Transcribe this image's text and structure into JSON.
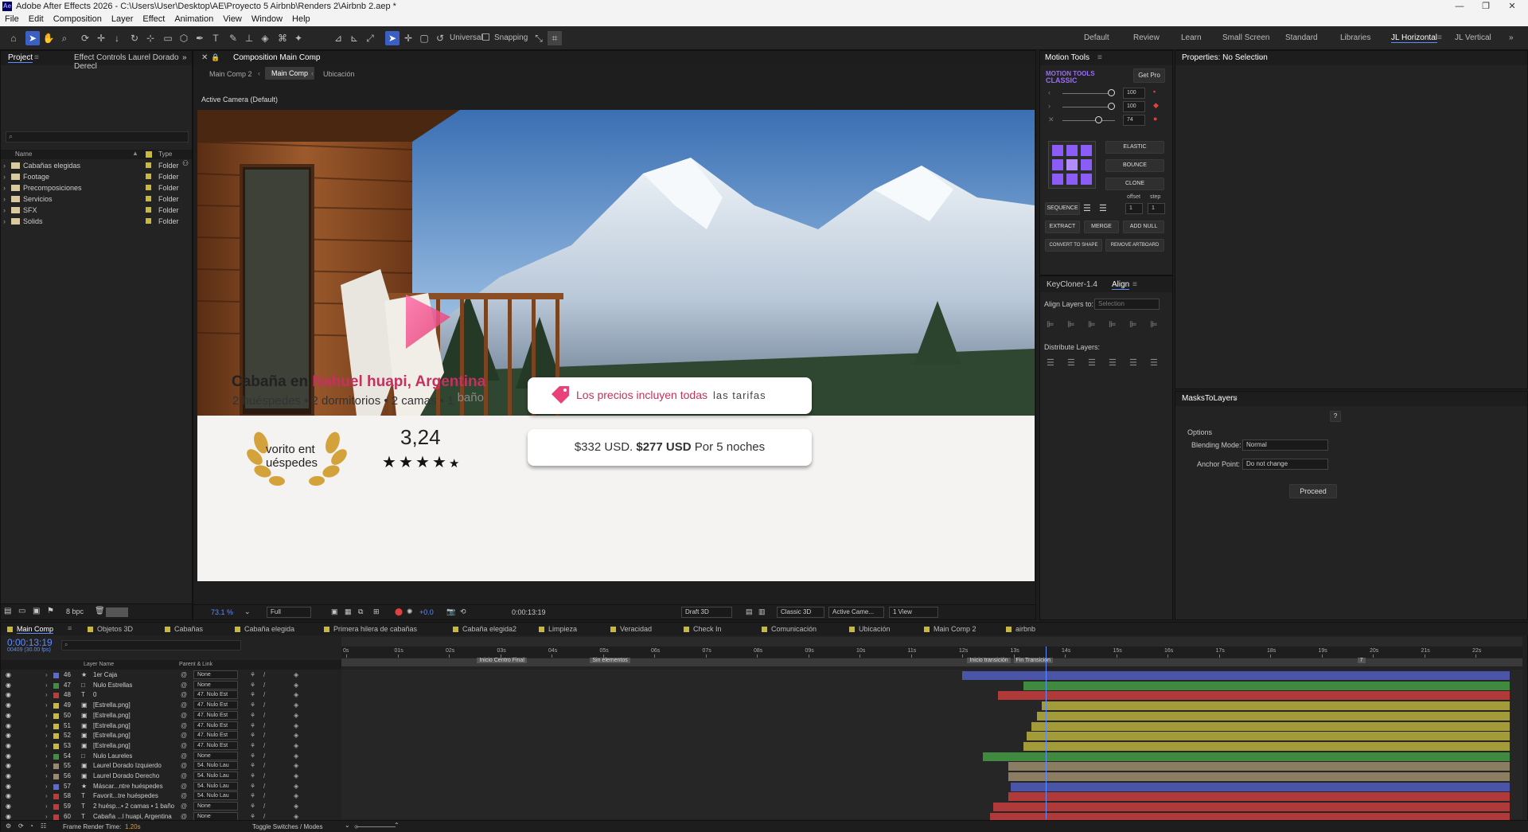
{
  "window": {
    "title": "Adobe After Effects 2026 - C:\\Users\\User\\Desktop\\AE\\Proyecto 5 Airbnb\\Renders 2\\Airbnb 2.aep *",
    "controls": [
      "—",
      "❐",
      "✕"
    ]
  },
  "menu": [
    "File",
    "Edit",
    "Composition",
    "Layer",
    "Effect",
    "Animation",
    "View",
    "Window",
    "Help"
  ],
  "toolbar": {
    "universal_label": "Universal",
    "snapping_label": "Snapping"
  },
  "workspaces": [
    "Default",
    "Review",
    "Learn",
    "Small Screen",
    "Standard",
    "Libraries",
    "JL Horizontal",
    "JL Vertical"
  ],
  "workspace_active": "JL Horizontal",
  "project_panel": {
    "tabs": [
      "Project",
      "Effect Controls Laurel Dorado Derecl"
    ],
    "search_placeholder": "",
    "columns": [
      "Name",
      "Type"
    ],
    "items": [
      {
        "name": "Cabañas elegidas",
        "type": "Folder"
      },
      {
        "name": "Footage",
        "type": "Folder"
      },
      {
        "name": "Precomposiciones",
        "type": "Folder"
      },
      {
        "name": "Servicios",
        "type": "Folder"
      },
      {
        "name": "SFX",
        "type": "Folder"
      },
      {
        "name": "Solids",
        "type": "Folder"
      }
    ],
    "bpc": "8 bpc"
  },
  "composition_panel": {
    "title": "Composition Main Comp",
    "breadcrumbs": [
      "Main Comp 2",
      "Main Comp",
      "Ubicación"
    ],
    "active_crumb": "Main Comp",
    "camera_label": "Active Camera (Default)",
    "footer": {
      "zoom": "73.1 %",
      "resolution": "Full",
      "exposure": "+0.0",
      "timecode": "0:00:13:19",
      "draft": "Draft 3D",
      "renderer": "Classic 3D",
      "camera": "Active Came...",
      "views": "1 View"
    }
  },
  "card": {
    "title_prefix": "Cabaña en ",
    "title_accent": "Nahuel huapi, Argentina",
    "subtitle": "2 huéspedes • 2 dormitorios • 2 camas • 1 ",
    "subtitle_tail": "baño",
    "laurel_text_line1": "vorito ent",
    "laurel_text_line2": "uéspedes",
    "rating": "3,24",
    "stars": [
      "★",
      "★",
      "★",
      "★",
      "★"
    ],
    "price_note_accent": "Los precios incluyen todas",
    "price_note_tail": "las tarifas",
    "price_old": "$332 USD.",
    "price_new": "$277 USD",
    "price_suffix": "Por 5 noches"
  },
  "motion_tools": {
    "tab": "Motion Tools",
    "brand_line1": "MOTION TOOLS",
    "brand_line2": "CLASSIC",
    "get_pro": "Get Pro",
    "sliders": [
      "100",
      "100",
      "74"
    ],
    "buttons": {
      "elastic": "ELASTIC",
      "bounce": "BOUNCE",
      "clone": "CLONE",
      "sequence": "SEQUENCE",
      "offset": "offset",
      "step": "step",
      "offset_val": "1",
      "step_val": "1",
      "extract": "EXTRACT",
      "merge": "MERGE",
      "add_null": "ADD NULL",
      "convert": "CONVERT TO SHAPE",
      "remove": "REMOVE ARTBOARD"
    }
  },
  "align_panel": {
    "tabs": [
      "KeyCloner-1.4",
      "Align"
    ],
    "align_to_label": "Align Layers to:",
    "align_to_value": "Selection",
    "distribute_label": "Distribute Layers:"
  },
  "properties_panel": {
    "title": "Properties: No Selection"
  },
  "masks_panel": {
    "title": "MasksToLayers",
    "help": "?",
    "options_label": "Options",
    "blending_label": "Blending Mode:",
    "blending_value": "Normal",
    "anchor_label": "Anchor Point:",
    "anchor_value": "Do not change",
    "proceed": "Proceed"
  },
  "timeline": {
    "tabs": [
      "Main Comp",
      "Objetos 3D",
      "Cabañas",
      "Cabaña elegida",
      "Primera hilera de cabañas",
      "Cabaña elegida2",
      "Limpieza",
      "Veracidad",
      "Check In",
      "Comunicación",
      "Ubicación",
      "Main Comp 2",
      "airbnb"
    ],
    "timecode": "0:00:13:19",
    "timecode_sub": "00409 (30.00 fps)",
    "columns": {
      "layer_name": "Layer Name",
      "parent": "Parent & Link"
    },
    "ruler": [
      "0s",
      "01s",
      "02s",
      "03s",
      "04s",
      "05s",
      "06s",
      "07s",
      "08s",
      "09s",
      "10s",
      "11s",
      "12s",
      "13s",
      "14s",
      "15s",
      "16s",
      "17s",
      "18s",
      "19s",
      "20s",
      "21s",
      "22s"
    ],
    "markers": [
      "Inicio Centro Final",
      "Sin elementos",
      "Inicio transición",
      "Fin Transición",
      "7"
    ],
    "playhead_seconds": 13.63,
    "layers": [
      {
        "num": "46",
        "color": "#5a6bd6",
        "type": "★",
        "name": "1er Caja",
        "parent": "None",
        "start": 12.0,
        "bar": "#4a55a8"
      },
      {
        "num": "47",
        "color": "#3f8f3f",
        "type": "□",
        "name": "Nulo Estrellas",
        "parent": "None",
        "start": 13.2,
        "bar": "#3f8a3f"
      },
      {
        "num": "48",
        "color": "#c03a3a",
        "type": "T",
        "name": "0",
        "parent": "47. Nulo Est",
        "start": 12.7,
        "bar": "#b03a3a"
      },
      {
        "num": "49",
        "color": "#c8b840",
        "type": "▣",
        "name": "[Estrella.png]",
        "parent": "47. Nulo Est",
        "start": 13.55,
        "bar": "#a39a3a"
      },
      {
        "num": "50",
        "color": "#c8b840",
        "type": "▣",
        "name": "[Estrella.png]",
        "parent": "47. Nulo Est",
        "start": 13.45,
        "bar": "#a39a3a"
      },
      {
        "num": "51",
        "color": "#c8b840",
        "type": "▣",
        "name": "[Estrella.png]",
        "parent": "47. Nulo Est",
        "start": 13.35,
        "bar": "#a39a3a"
      },
      {
        "num": "52",
        "color": "#c8b840",
        "type": "▣",
        "name": "[Estrella.png]",
        "parent": "47. Nulo Est",
        "start": 13.25,
        "bar": "#a39a3a"
      },
      {
        "num": "53",
        "color": "#c8b840",
        "type": "▣",
        "name": "[Estrella.png]",
        "parent": "47. Nulo Est",
        "start": 13.2,
        "bar": "#a39a3a"
      },
      {
        "num": "54",
        "color": "#3f8f3f",
        "type": "□",
        "name": "Nulo Laureles",
        "parent": "None",
        "start": 12.4,
        "bar": "#3f8a3f"
      },
      {
        "num": "55",
        "color": "#9a8a6a",
        "type": "▣",
        "name": "Laurel Dorado Izquierdo",
        "parent": "54. Nulo Lau",
        "start": 12.9,
        "bar": "#8a7d62"
      },
      {
        "num": "56",
        "color": "#9a8a6a",
        "type": "▣",
        "name": "Laurel Dorado Derecho",
        "parent": "54. Nulo Lau",
        "start": 12.9,
        "bar": "#8a7d62"
      },
      {
        "num": "57",
        "color": "#5a6bd6",
        "type": "★",
        "name": "Máscar...ntre huéspedes",
        "parent": "54. Nulo Lau",
        "start": 12.95,
        "bar": "#4a55a8"
      },
      {
        "num": "58",
        "color": "#c03a3a",
        "type": "T",
        "name": "Favorit...tre huéspedes",
        "parent": "54. Nulo Lau",
        "start": 12.9,
        "bar": "#b03a3a"
      },
      {
        "num": "59",
        "color": "#c03a3a",
        "type": "T",
        "name": "2 huésp...• 2 camas • 1 baño",
        "parent": "None",
        "start": 12.6,
        "bar": "#b03a3a"
      },
      {
        "num": "60",
        "color": "#c03a3a",
        "type": "T",
        "name": "Cabaña ...l huapi, Argentina",
        "parent": "None",
        "start": 12.55,
        "bar": "#b03a3a"
      }
    ],
    "footer": {
      "frame_render_label": "Frame Render Time:",
      "frame_render_value": "1.20s",
      "toggle_label": "Toggle Switches / Modes"
    }
  }
}
